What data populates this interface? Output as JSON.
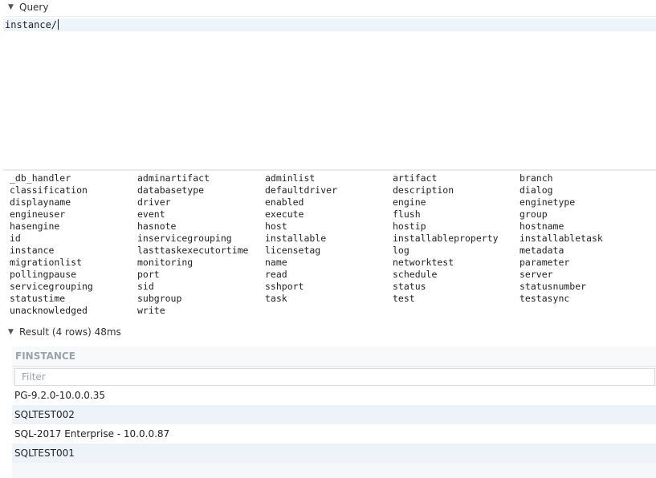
{
  "query": {
    "header_label": "Query",
    "text": "instance/"
  },
  "keywords": [
    "_db_handler",
    "adminartifact",
    "adminlist",
    "artifact",
    "branch",
    "classification",
    "databasetype",
    "defaultdriver",
    "description",
    "dialog",
    "displayname",
    "driver",
    "enabled",
    "engine",
    "enginetype",
    "engineuser",
    "event",
    "execute",
    "flush",
    "group",
    "hasengine",
    "hasnote",
    "host",
    "hostip",
    "hostname",
    "id",
    "inservicegrouping",
    "installable",
    "installableproperty",
    "installabletask",
    "instance",
    "lasttaskexecutortime",
    "licensetag",
    "log",
    "metadata",
    "migrationlist",
    "monitoring",
    "name",
    "networktest",
    "parameter",
    "pollingpause",
    "port",
    "read",
    "schedule",
    "server",
    "servicegrouping",
    "sid",
    "sshport",
    "status",
    "statusnumber",
    "statustime",
    "subgroup",
    "task",
    "test",
    "testasync",
    "unacknowledged",
    "write"
  ],
  "result": {
    "header_label": "Result (4 rows) 48ms",
    "column": "FINSTANCE",
    "filter_placeholder": "Filter",
    "rows": [
      "PG-9.2.0-10.0.0.35",
      "SQLTEST002",
      "SQL-2017 Enterprise - 10.0.0.87",
      "SQLTEST001"
    ]
  }
}
